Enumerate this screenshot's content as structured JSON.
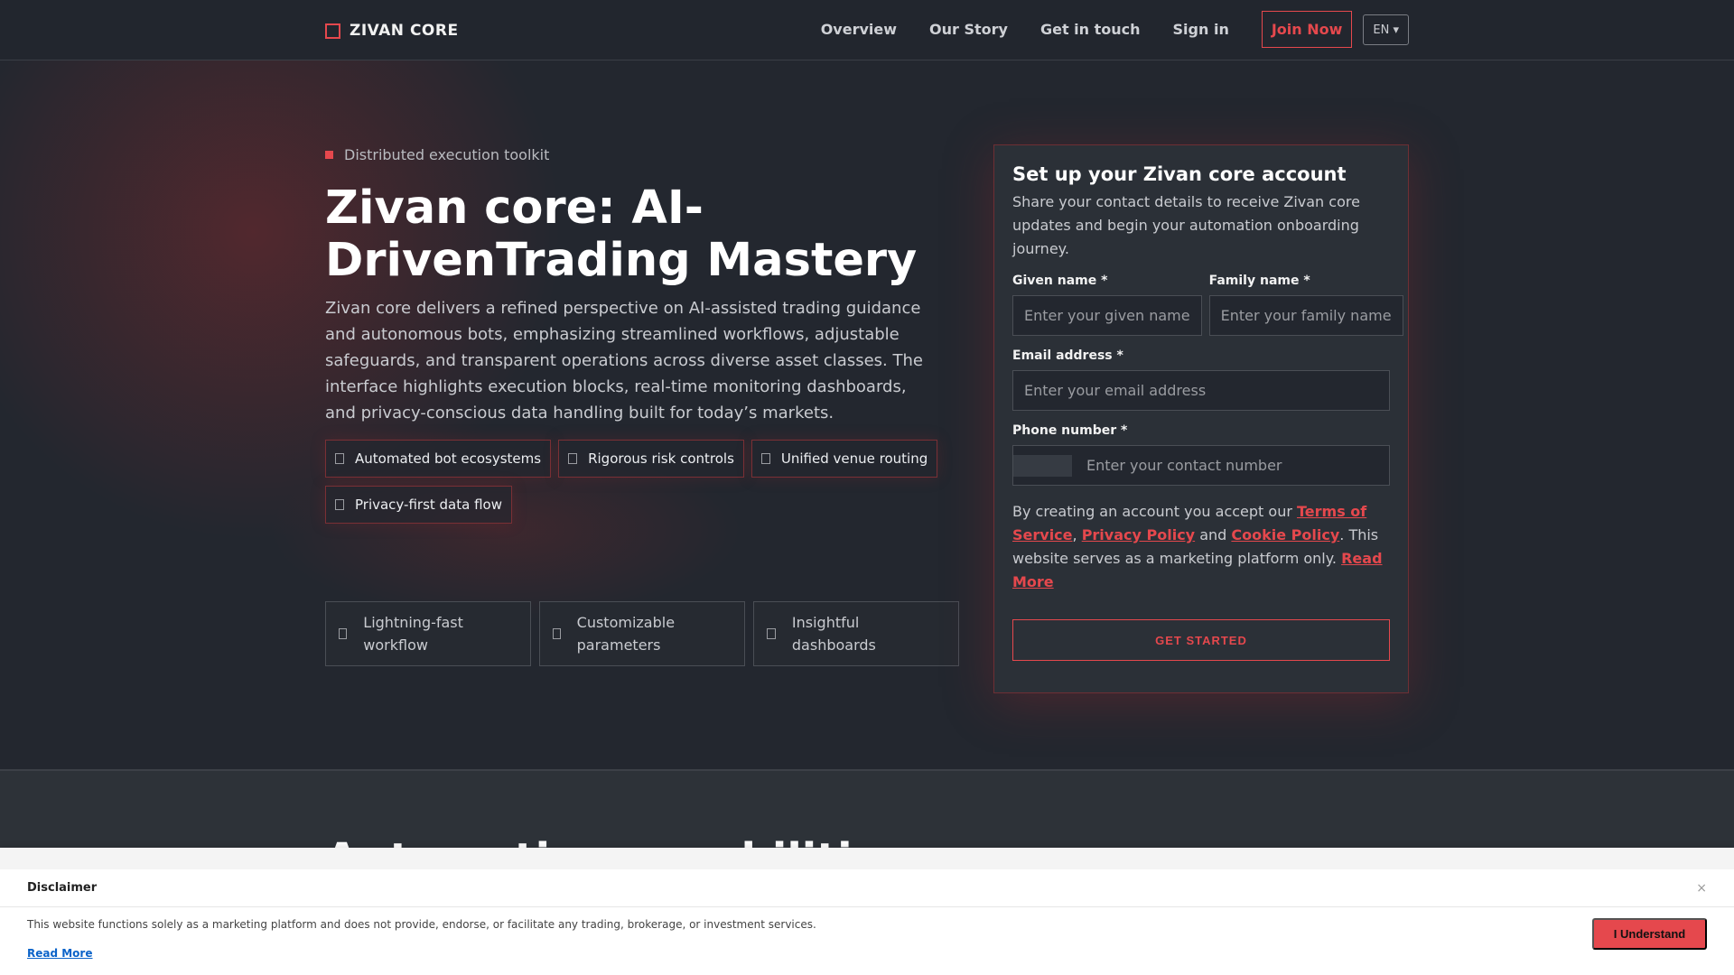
{
  "nav": {
    "brand": "ZIVAN CORE",
    "links": [
      "Overview",
      "Our Story",
      "Get in touch",
      "Sign in"
    ],
    "join": "Join Now",
    "lang": "EN ▾"
  },
  "hero": {
    "tag": "Distributed execution toolkit",
    "title": "Zivan core: AI-DrivenTrading Mastery",
    "desc": "Zivan core delivers a refined perspective on AI-assisted trading guidance and autonomous bots, emphasizing streamlined workflows, adjustable safeguards, and transparent operations across diverse asset classes. The interface highlights execution blocks, real-time monitoring dashboards, and privacy-conscious data handling built for today’s markets.",
    "chips": [
      "Automated bot ecosystems",
      "Rigorous risk controls",
      "Unified venue routing",
      "Privacy-first data flow"
    ],
    "features": [
      "Lightning-fast workflow",
      "Customizable parameters",
      "Insightful dashboards"
    ]
  },
  "form": {
    "title": "Set up your Zivan core account",
    "subtitle": "Share your contact details to receive Zivan core updates and begin your automation onboarding journey.",
    "given_label": "Given name *",
    "given_ph": "Enter your given name",
    "family_label": "Family name *",
    "family_ph": "Enter your family name",
    "email_label": "Email address *",
    "email_ph": "Enter your email address",
    "phone_label": "Phone number *",
    "phone_ph": "Enter your contact number",
    "terms_pre": "By creating an account you accept our ",
    "tos": "Terms of Service",
    "comma": ", ",
    "privacy": "Privacy Policy",
    "and": " and ",
    "cookie": "Cookie Policy",
    "terms_post": ". This website serves as a marketing platform only. ",
    "read_more": "Read More",
    "cta": "GET STARTED"
  },
  "section2": {
    "title": "Automation capabilities"
  },
  "disclaimer": {
    "title": "Disclaimer",
    "close": "×",
    "text": "This website functions solely as a marketing platform and does not provide, endorse, or facilitate any trading, brokerage, or investment services.",
    "read_more": "Read More",
    "button": "I Understand"
  }
}
